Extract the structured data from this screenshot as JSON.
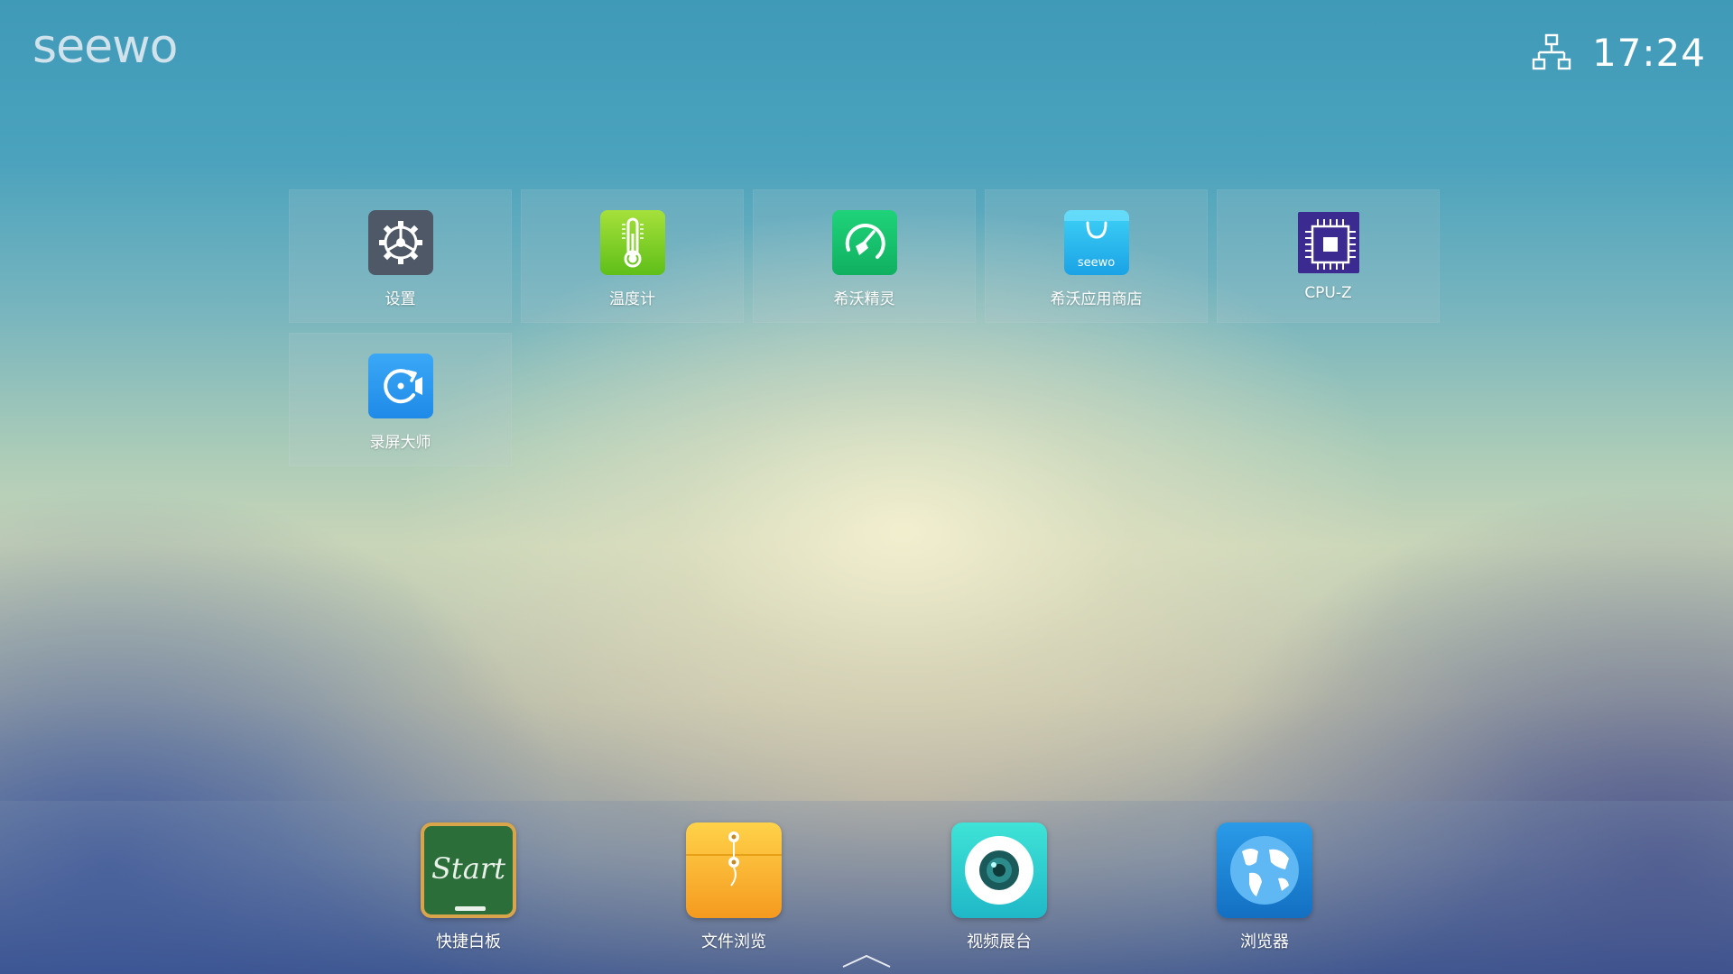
{
  "brand": {
    "logo_text": "seewo"
  },
  "status": {
    "time": "17:24",
    "network_icon": "network-icon"
  },
  "apps": [
    {
      "label": "设置",
      "icon": "settings-gear-icon"
    },
    {
      "label": "温度计",
      "icon": "thermometer-icon"
    },
    {
      "label": "希沃精灵",
      "icon": "broom-cleaner-icon"
    },
    {
      "label": "希沃应用商店",
      "icon": "shopping-bag-icon",
      "icon_text": "seewo"
    },
    {
      "label": "CPU-Z",
      "icon": "cpu-chip-icon"
    },
    {
      "label": "录屏大师",
      "icon": "screen-record-icon"
    }
  ],
  "dock": [
    {
      "label": "快捷白板",
      "icon": "chalkboard-icon",
      "icon_text": "Start"
    },
    {
      "label": "文件浏览",
      "icon": "folder-envelope-icon"
    },
    {
      "label": "视频展台",
      "icon": "camera-lens-icon"
    },
    {
      "label": "浏览器",
      "icon": "globe-icon"
    }
  ],
  "colors": {
    "settings": "#4e5866",
    "thermometer": "#86d21f",
    "cleaner": "#16c06a",
    "store": "#2fb9ee",
    "cpuz": "#3b2a8f",
    "recorder": "#2f9af2"
  }
}
